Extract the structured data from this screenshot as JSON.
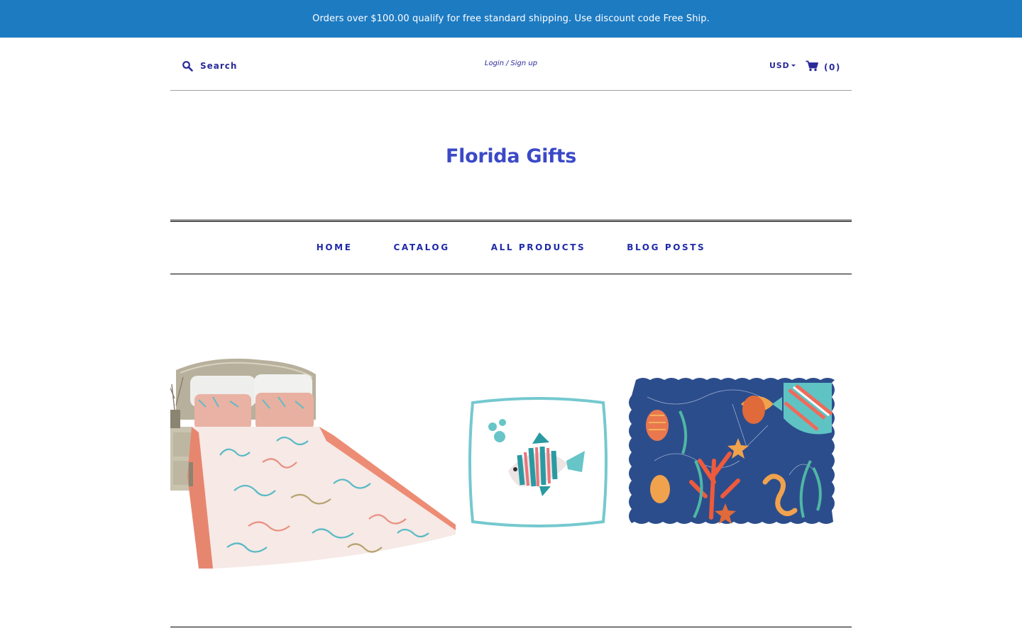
{
  "announcement": "Orders over $100.00 qualify for free standard shipping. Use discount code Free Ship.",
  "header": {
    "search_label": "Search",
    "login_label": "Login",
    "separator": "/",
    "signup_label": "Sign up",
    "currency": "USD",
    "cart_count": "(0)"
  },
  "logo": "Florida Gifts",
  "nav": {
    "items": [
      "HOME",
      "CATALOG",
      "ALL PRODUCTS",
      "BLOG POSTS"
    ]
  },
  "products": [
    {
      "icon": "coral-quilt-bedding-image"
    },
    {
      "icon": "tropical-fish-pillow-image"
    },
    {
      "icon": "sea-life-placemat-image"
    }
  ],
  "colors": {
    "announcement_bg": "#1d7bc2",
    "nav_text": "#1f2aa8",
    "logo": "#3b49c7"
  }
}
